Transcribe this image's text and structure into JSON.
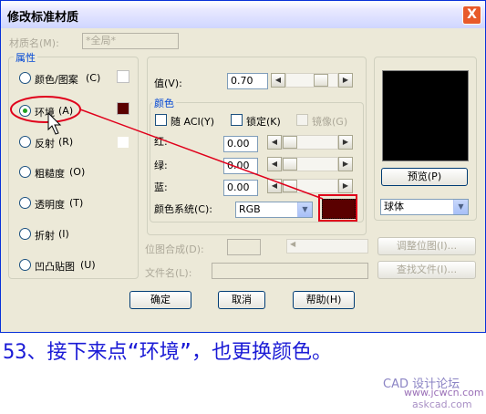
{
  "dialog": {
    "title": "修改标准材质",
    "close_label": "X",
    "material_name_label": "材质名(M):",
    "material_name_value": "*全局*"
  },
  "attributes": {
    "group_title": "属性",
    "items": [
      {
        "label": "颜色/图案",
        "key": "(C)",
        "checked": false
      },
      {
        "label": "环境",
        "key": "(A)",
        "checked": true
      },
      {
        "label": "反射",
        "key": "(R)",
        "checked": false
      },
      {
        "label": "粗糙度",
        "key": "(O)",
        "checked": false
      },
      {
        "label": "透明度",
        "key": "(T)",
        "checked": false
      },
      {
        "label": "折射",
        "key": "(I)",
        "checked": false
      },
      {
        "label": "凹凸贴图",
        "key": "(U)",
        "checked": false
      }
    ]
  },
  "value": {
    "label": "值(V):",
    "input": "0.70"
  },
  "color": {
    "group_title": "颜色",
    "by_aci_label": "随 ACI(Y)",
    "lock_label": "锁定(K)",
    "mirror_label": "镜像(G)",
    "red_label": "红:",
    "red_value": "0.00",
    "green_label": "绿:",
    "green_value": "0.00",
    "blue_label": "蓝:",
    "blue_value": "0.00",
    "system_label": "颜色系统(C):",
    "system_value": "RGB",
    "swatch_color": "#5a0000"
  },
  "preview": {
    "button_label": "预览(P)",
    "shape_value": "球体"
  },
  "bitmap": {
    "blend_label": "位图合成(D):",
    "adjust_label": "调整位图(I)...",
    "file_label": "文件名(L):",
    "find_label": "查找文件(I)..."
  },
  "buttons": {
    "ok": "确定",
    "cancel": "取消",
    "help": "帮助(H)"
  },
  "caption": "53、接下来点“环境”，也更换颜色。",
  "watermark": {
    "line1": "CAD 设计论坛",
    "line2": "www.jcwcn.com",
    "line3": "askcad.com"
  },
  "colors": {
    "accent_red": "#e0001b",
    "env_swatch": "#5a0000"
  }
}
